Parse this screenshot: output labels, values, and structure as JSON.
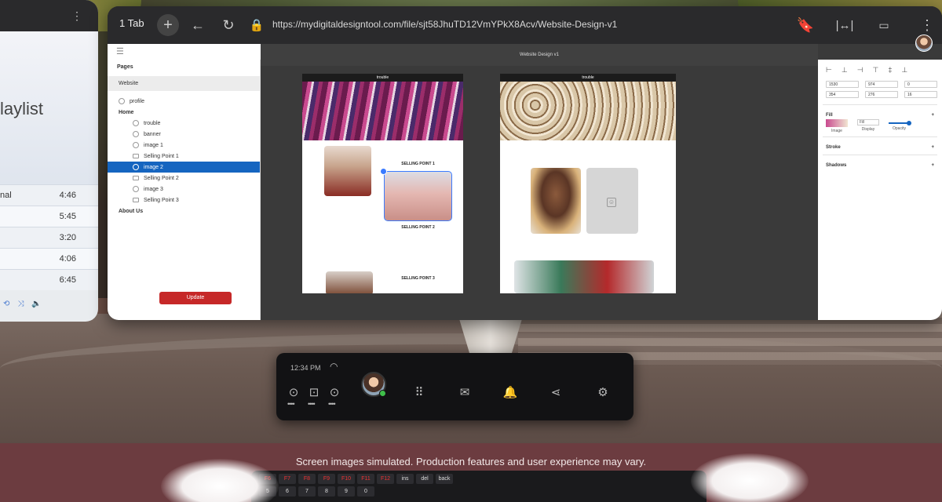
{
  "left_window": {
    "playlist_title": "laylist",
    "tracks": [
      {
        "name": "nal",
        "duration": "4:46"
      },
      {
        "name": "",
        "duration": "5:45"
      },
      {
        "name": "",
        "duration": "3:20"
      },
      {
        "name": "",
        "duration": "4:06"
      },
      {
        "name": "",
        "duration": "6:45"
      }
    ]
  },
  "browser": {
    "tab_count": "1 Tab",
    "url": "https://mydigitaldesigntool.com/file/sjt58JhuTD12VmYPkX8Acv/Website-Design-v1",
    "document_title": "Website Design v1"
  },
  "layers": {
    "pages_heading": "Pages",
    "pages": [
      "Website"
    ],
    "items": [
      {
        "label": "profile",
        "indent": false,
        "selected": false,
        "bold": false,
        "icon": "circle-icon"
      },
      {
        "label": "Home",
        "indent": false,
        "selected": false,
        "bold": true,
        "icon": ""
      },
      {
        "label": "trouble",
        "indent": true,
        "selected": false,
        "bold": false,
        "icon": "text-icon"
      },
      {
        "label": "banner",
        "indent": true,
        "selected": false,
        "bold": false,
        "icon": "image-icon"
      },
      {
        "label": "image 1",
        "indent": true,
        "selected": false,
        "bold": false,
        "icon": "image-icon"
      },
      {
        "label": "Selling Point 1",
        "indent": true,
        "selected": false,
        "bold": false,
        "icon": "folder-icon"
      },
      {
        "label": "image 2",
        "indent": true,
        "selected": true,
        "bold": false,
        "icon": "image-icon"
      },
      {
        "label": "Selling Point 2",
        "indent": true,
        "selected": false,
        "bold": false,
        "icon": "folder-icon"
      },
      {
        "label": "image 3",
        "indent": true,
        "selected": false,
        "bold": false,
        "icon": "image-icon"
      },
      {
        "label": "Selling Point 3",
        "indent": true,
        "selected": false,
        "bold": false,
        "icon": "folder-icon"
      },
      {
        "label": "About Us",
        "indent": false,
        "selected": false,
        "bold": true,
        "icon": ""
      }
    ],
    "update_label": "Update"
  },
  "canvas": {
    "board1": {
      "brand": "trouble",
      "selling_point_1": "SELLING POINT 1",
      "selling_point_2": "SELLING POINT 2",
      "selling_point_3": "SELLING POINT 3"
    },
    "board2": {
      "brand": "trouble"
    }
  },
  "properties": {
    "fields": [
      "1530",
      "974",
      "0",
      "354",
      "276",
      "16"
    ],
    "fill_heading": "Fill",
    "fill_image_label": "Image",
    "fill_mode": "Fill",
    "display_label": "Display",
    "opacity_label": "Opacity",
    "opacity": 0.9,
    "stroke_heading": "Stroke",
    "shadows_heading": "Shadows"
  },
  "dock": {
    "time": "12:34 PM"
  },
  "caption": "Screen images simulated. Production features and user experience may vary.",
  "keyboard_keys": [
    "F6",
    "F7",
    "F8",
    "F9",
    "F10",
    "F11",
    "F12",
    "ins",
    "del",
    "back",
    "5",
    "6",
    "7",
    "8",
    "9",
    "0"
  ],
  "colors": {
    "accent": "#1565c0",
    "update_button": "#c62828",
    "secure": "#3fbf4a"
  }
}
